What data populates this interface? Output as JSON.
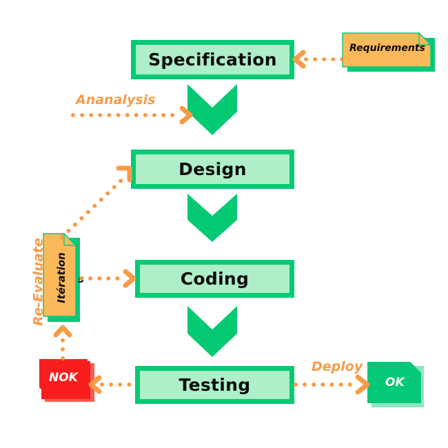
{
  "diagram": {
    "title_text_absent": "",
    "colors": {
      "stage_fill": "#AEEFC9",
      "stage_border": "#06CA73",
      "accent_orange": "#F89B48",
      "note_orange_fill": "#FBB95A",
      "note_red_fill": "#F81E1E",
      "note_green_fill": "#05C878",
      "text_dark": "#0b0b0b",
      "text_light": "#ffffff"
    },
    "stages": [
      {
        "id": "specification",
        "label": "Specification"
      },
      {
        "id": "design",
        "label": "Design"
      },
      {
        "id": "coding",
        "label": "Coding"
      },
      {
        "id": "testing",
        "label": "Testing"
      }
    ],
    "notes": [
      {
        "id": "requirements",
        "label": "Requirements"
      },
      {
        "id": "iteration",
        "label": "Itération"
      },
      {
        "id": "nok",
        "label": "NOK"
      },
      {
        "id": "ok",
        "label": "OK"
      }
    ],
    "edge_labels": [
      {
        "id": "ananalysis",
        "label": "Ananalysis"
      },
      {
        "id": "re_evaluate",
        "label": "Re-Evaluate"
      },
      {
        "id": "deploy",
        "label": "Deploy"
      }
    ],
    "stray_text": {
      "id": "iteration-overflow",
      "label": "s"
    },
    "flow_arrows": [
      {
        "id": "spec-to-design",
        "kind": "chevron-down"
      },
      {
        "id": "design-to-coding",
        "kind": "chevron-down"
      },
      {
        "id": "coding-to-testing",
        "kind": "chevron-down"
      }
    ],
    "dotted_connectors": [
      {
        "id": "requirements-to-specification",
        "kind": "dotted-arrow-left"
      },
      {
        "id": "ananalysis-to-flow",
        "kind": "dotted-arrow-right"
      },
      {
        "id": "iteration-to-design",
        "kind": "dotted-arrow-diagonal-up-right"
      },
      {
        "id": "iteration-to-coding",
        "kind": "dotted-arrow-right"
      },
      {
        "id": "nok-to-iteration",
        "kind": "dotted-arrow-up"
      },
      {
        "id": "testing-to-nok",
        "kind": "dotted-arrow-left"
      },
      {
        "id": "testing-to-ok",
        "kind": "dotted-arrow-right"
      }
    ]
  }
}
